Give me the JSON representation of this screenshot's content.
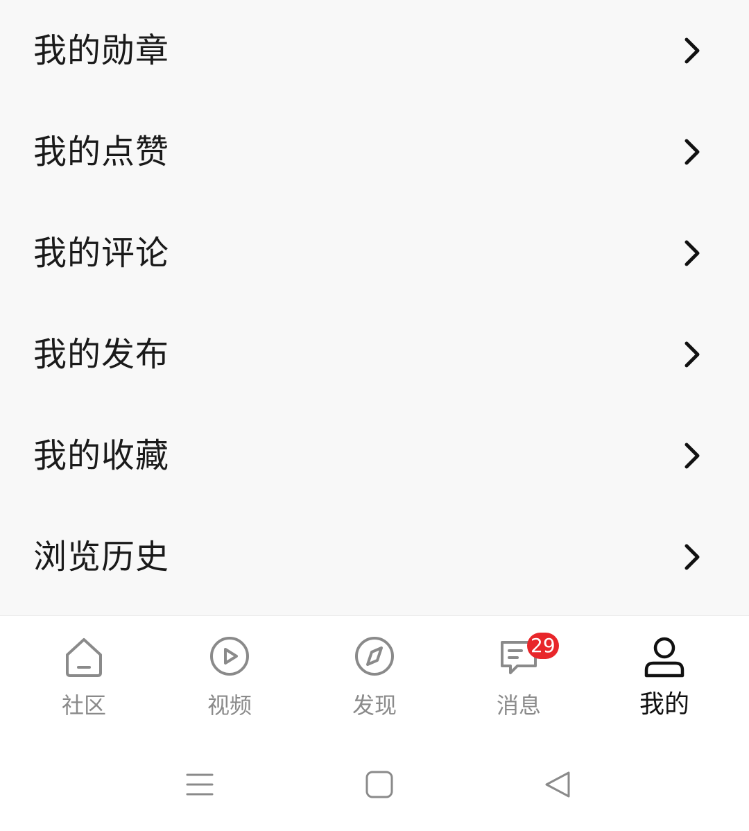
{
  "menu": {
    "items": [
      {
        "label": "我的勋章",
        "icon": "chevron-right-icon"
      },
      {
        "label": "我的点赞",
        "icon": "chevron-right-icon"
      },
      {
        "label": "我的评论",
        "icon": "chevron-right-icon"
      },
      {
        "label": "我的发布",
        "icon": "chevron-right-icon"
      },
      {
        "label": "我的收藏",
        "icon": "chevron-right-icon"
      },
      {
        "label": "浏览历史",
        "icon": "chevron-right-icon"
      }
    ]
  },
  "tab_bar": {
    "tabs": [
      {
        "label": "社区",
        "icon": "home-icon",
        "active": false
      },
      {
        "label": "视频",
        "icon": "play-icon",
        "active": false
      },
      {
        "label": "发现",
        "icon": "compass-icon",
        "active": false
      },
      {
        "label": "消息",
        "icon": "message-icon",
        "active": false,
        "badge": "29"
      },
      {
        "label": "我的",
        "icon": "person-icon",
        "active": true
      }
    ]
  },
  "system_nav": {
    "buttons": [
      "menu-icon",
      "home-square-icon",
      "back-triangle-icon"
    ]
  },
  "colors": {
    "background": "#f8f8f8",
    "tab_active": "#111111",
    "tab_inactive": "#8a8a8a",
    "badge": "#e8262a"
  }
}
